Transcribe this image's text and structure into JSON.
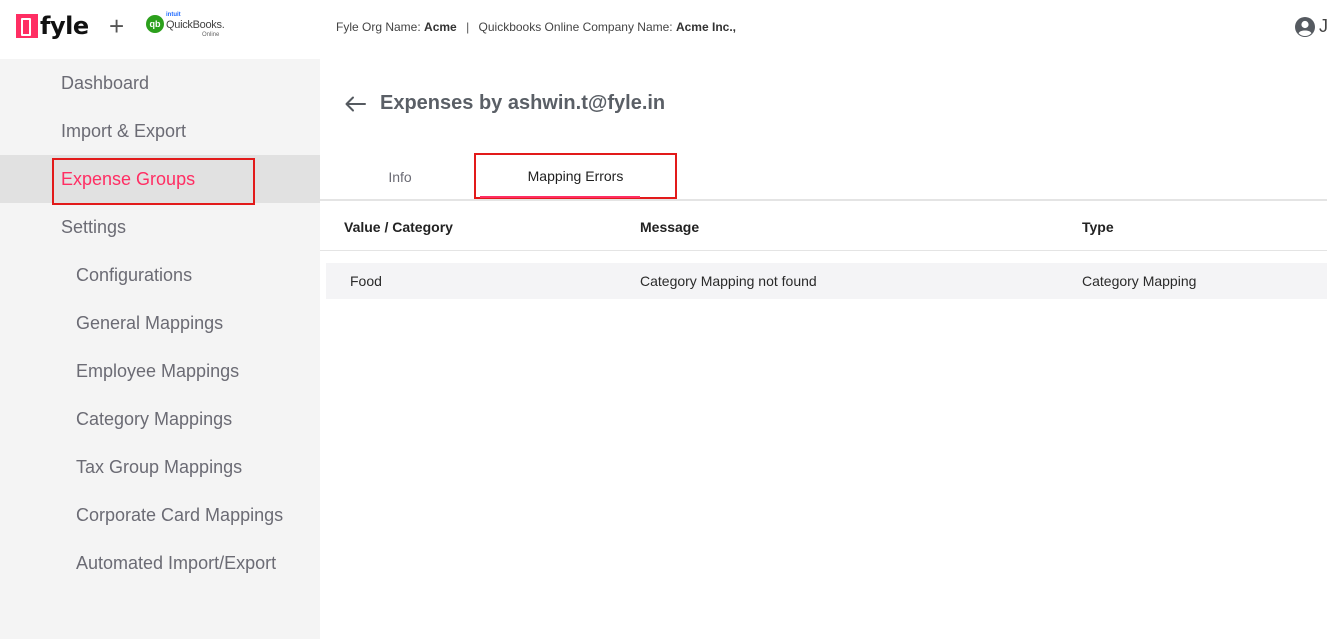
{
  "header": {
    "logo_text": "fyle",
    "plus": "+",
    "qb": {
      "badge": "qb",
      "intuit": "intuit",
      "name": "QuickBooks.",
      "online": "Online"
    },
    "org_label": "Fyle Org Name:",
    "org_value": "Acme",
    "separator": "|",
    "company_label": "Quickbooks Online Company Name:",
    "company_value": "Acme Inc.,",
    "user_initial": "J"
  },
  "sidebar": {
    "items": [
      {
        "label": "Dashboard"
      },
      {
        "label": "Import & Export"
      },
      {
        "label": "Expense Groups",
        "active": true
      },
      {
        "label": "Settings"
      },
      {
        "label": "Configurations"
      },
      {
        "label": "General Mappings"
      },
      {
        "label": "Employee Mappings"
      },
      {
        "label": "Category Mappings"
      },
      {
        "label": "Tax Group Mappings"
      },
      {
        "label": "Corporate Card Mappings"
      },
      {
        "label": "Automated Import/Export"
      }
    ]
  },
  "main": {
    "title": "Expenses by ashwin.t@fyle.in",
    "tabs": [
      {
        "label": "Info"
      },
      {
        "label": "Mapping Errors",
        "selected": true
      }
    ],
    "table": {
      "columns": [
        "Value / Category",
        "Message",
        "Type"
      ],
      "rows": [
        [
          "Food",
          "Category Mapping not found",
          "Category Mapping"
        ]
      ]
    }
  },
  "colors": {
    "brand": "#ff2e63",
    "highlight_box": "#e21a1a",
    "sidebar_bg": "#f4f4f4",
    "sidebar_active_bg": "#e1e1e1",
    "quickbooks_green": "#2ca01c"
  },
  "icons": {
    "user": "user-circle-icon",
    "back": "arrow-left-icon"
  }
}
